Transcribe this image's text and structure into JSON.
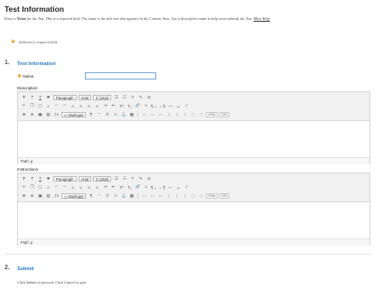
{
  "page": {
    "title": "Test Information",
    "intro_prefix": "Enter a ",
    "intro_bold": "Name",
    "intro_text": " for the Test. This is a required field. The name is the title text that appears in the Content Area. Use a descriptive name to help users identify the Test. ",
    "intro_link": "More Help",
    "required_note": "Indicates a required field."
  },
  "steps": [
    {
      "number": "1.",
      "title": "Test Information"
    },
    {
      "number": "2.",
      "title": "Submit"
    }
  ],
  "form": {
    "name_label": "Name",
    "name_value": "",
    "description_label": "Description",
    "instructions_label": "Instructions"
  },
  "toolbar": {
    "paragraph": "Paragraph",
    "font": "Arial",
    "size": "3 (12pt)",
    "mashups": "Mashups",
    "html_tag": "HTML",
    "css_tag": "CSS"
  },
  "editor": {
    "path_label": "Path: p"
  },
  "submit": {
    "note": "Click Submit to proceed. Click Cancel to quit."
  },
  "colors": {
    "accent": "#2a7bc0",
    "required_star": "#e8a33a"
  }
}
